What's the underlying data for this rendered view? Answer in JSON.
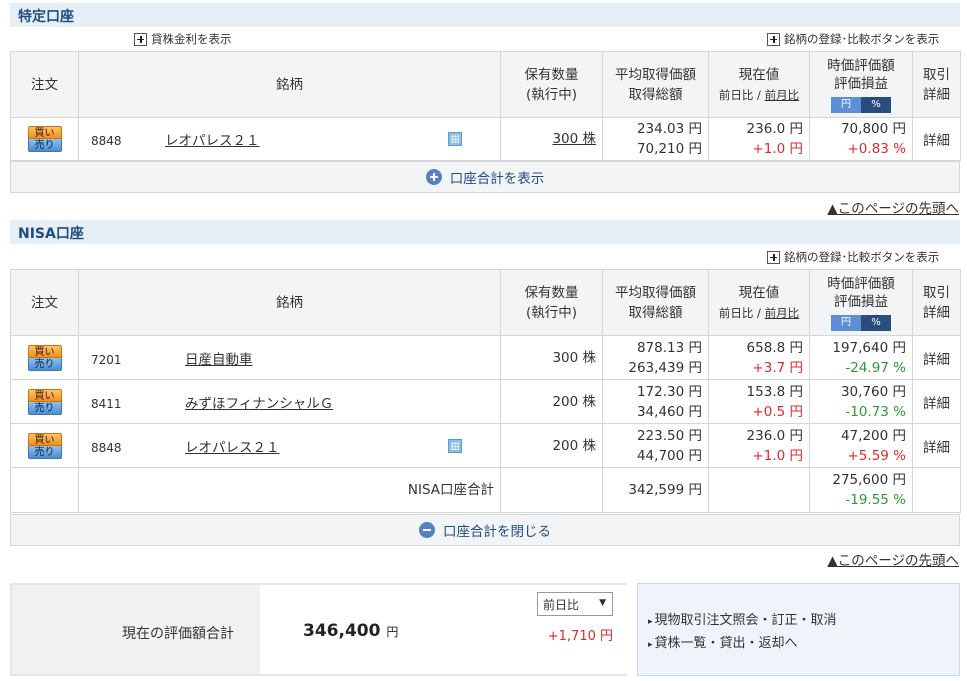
{
  "tokutei": {
    "title": "特定口座",
    "lending_link": "貸株金利を表示",
    "compare_link": "銘柄の登録･比較ボタンを表示",
    "headers": {
      "order": "注文",
      "name": "銘柄",
      "qty1": "保有数量",
      "qty2": "(執行中)",
      "avg1": "平均取得価額",
      "avg2": "取得総額",
      "price1": "現在値",
      "price_sub_a": "前日比",
      "price_sub_sep": " / ",
      "price_sub_b": "前月比",
      "val1": "時価評価額",
      "val2": "評価損益",
      "toggle_yen": "円",
      "toggle_pct": "%",
      "trade1": "取引",
      "trade2": "詳細"
    },
    "rows": [
      {
        "code": "8848",
        "name": "レオパレス２１",
        "qty": "300 株",
        "avg": "234.03 円",
        "total": "70,210 円",
        "price": "236.0 円",
        "change": "+1.0 円",
        "value": "70,800 円",
        "pl": "+0.83 %",
        "detail": "詳細"
      }
    ],
    "footer_bar": "口座合計を表示"
  },
  "nisa": {
    "title": "NISA口座",
    "compare_link": "銘柄の登録･比較ボタンを表示",
    "rows": [
      {
        "code": "7201",
        "name": "日産自動車",
        "qty": "300 株",
        "avg": "878.13 円",
        "total": "263,439 円",
        "price": "658.8 円",
        "change": "+3.7 円",
        "value": "197,640 円",
        "pl": "-24.97 %",
        "detail": "詳細"
      },
      {
        "code": "8411",
        "name": "みずほフィナンシャルＧ",
        "qty": "200 株",
        "avg": "172.30 円",
        "total": "34,460 円",
        "price": "153.8 円",
        "change": "+0.5 円",
        "value": "30,760 円",
        "pl": "-10.73 %",
        "detail": "詳細"
      },
      {
        "code": "8848",
        "name": "レオパレス２１",
        "qty": "200 株",
        "avg": "223.50 円",
        "total": "44,700 円",
        "price": "236.0 円",
        "change": "+1.0 円",
        "value": "47,200 円",
        "pl": "+5.59 %",
        "detail": "詳細"
      }
    ],
    "sum_label": "NISA口座合計",
    "sum_total": "342,599 円",
    "sum_value": "275,600 円",
    "sum_pl": "-19.55 %",
    "footer_bar": "口座合計を閉じる"
  },
  "buy_label": "買い",
  "sell_label": "売り",
  "page_top": "▲このページの先頭へ",
  "summary": {
    "label": "現在の評価額合計",
    "value": "346,400",
    "unit": "円",
    "select": "前日比",
    "diff": "+1,710 円"
  },
  "links": {
    "l1": "現物取引注文照会・訂正・取消",
    "l2": "貸株一覧・貸出・返却へ",
    "arrow": "▸"
  },
  "colors": {
    "positive": "#e0282f",
    "negative": "#2d9a3a",
    "accent": "#1d4d85"
  }
}
